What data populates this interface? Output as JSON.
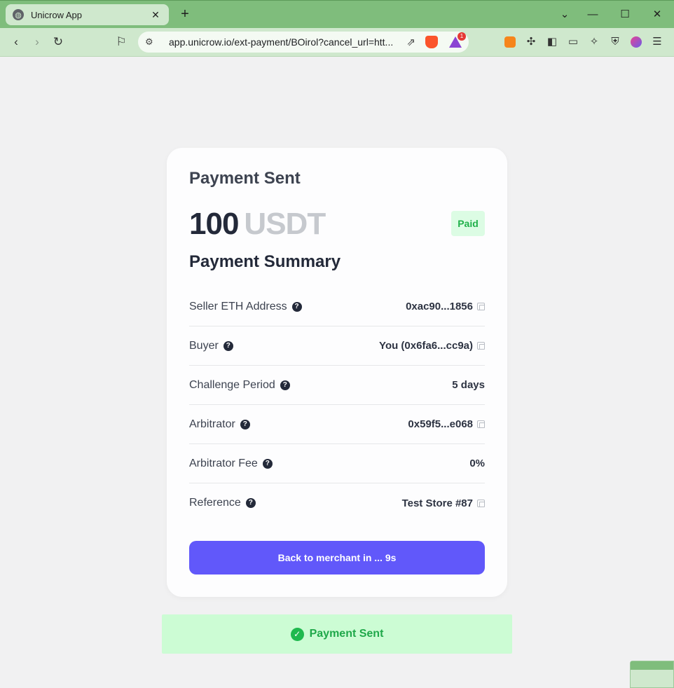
{
  "browser": {
    "tab_title": "Unicrow App",
    "url": "app.unicrow.io/ext-payment/BOirol?cancel_url=htt...",
    "rewards_badge": "1"
  },
  "card": {
    "title": "Payment Sent",
    "amount": "100",
    "currency": "USDT",
    "status": "Paid",
    "summary_title": "Payment Summary",
    "rows": [
      {
        "label": "Seller ETH Address",
        "value": "0xac90...1856"
      },
      {
        "label": "Buyer",
        "value": "You (0x6fa6...cc9a)"
      },
      {
        "label": "Challenge Period",
        "value": "5 days"
      },
      {
        "label": "Arbitrator",
        "value": "0x59f5...e068"
      },
      {
        "label": "Arbitrator Fee",
        "value": "0%"
      },
      {
        "label": "Reference",
        "value": "Test Store #87"
      }
    ],
    "back_button": "Back to merchant in ... 9s"
  },
  "toast": {
    "message": "Payment Sent"
  },
  "colors": {
    "accent": "#6158fa",
    "success": "#1fb94e",
    "browser_frame": "#7fbd7c"
  }
}
